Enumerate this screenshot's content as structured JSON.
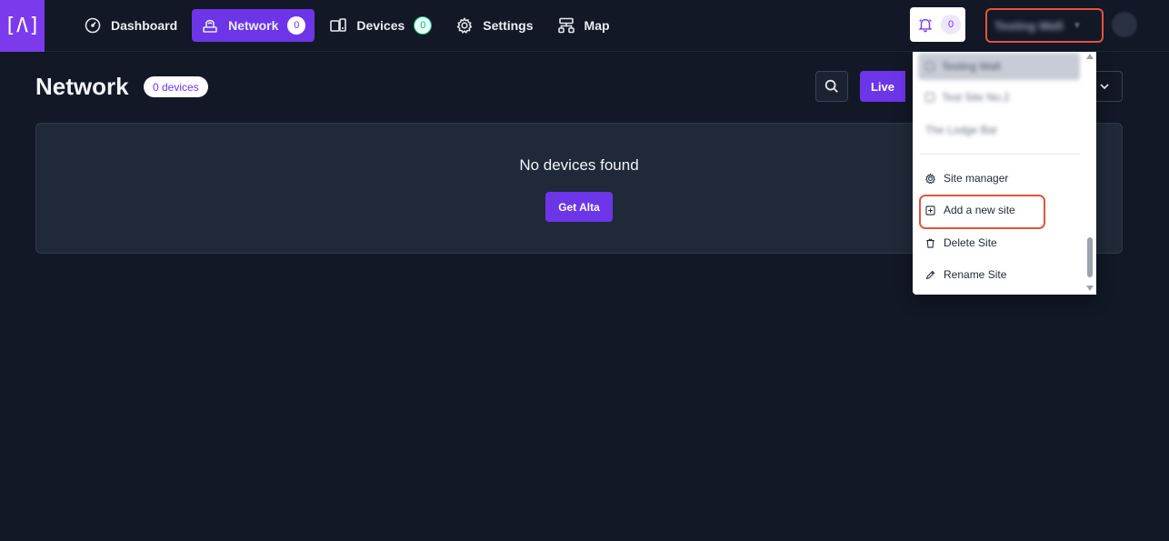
{
  "nav": {
    "logo_text": "[Λ]",
    "items": [
      {
        "label": "Dashboard",
        "icon": "gauge-icon"
      },
      {
        "label": "Network",
        "icon": "router-icon",
        "count": "0",
        "active": true
      },
      {
        "label": "Devices",
        "icon": "devices-icon",
        "count": "0"
      },
      {
        "label": "Settings",
        "icon": "gear-icon"
      },
      {
        "label": "Map",
        "icon": "sitemap-icon"
      }
    ],
    "notifications_count": "0",
    "site_selector_label": "Testing Wafi"
  },
  "page": {
    "title": "Network",
    "devices_pill": "0 devices",
    "live_label": "Live"
  },
  "empty_state": {
    "message": "No devices found",
    "button_label": "Get Alta"
  },
  "dropdown": {
    "sites": [
      "Testing Wafi",
      "Test Site No.2",
      "The Lodge Bar"
    ],
    "actions": [
      {
        "label": "Site manager",
        "icon": "gear-icon"
      },
      {
        "label": "Add a new site",
        "icon": "plus-square-icon"
      },
      {
        "label": "Delete Site",
        "icon": "trash-icon"
      },
      {
        "label": "Rename Site",
        "icon": "pencil-icon"
      }
    ]
  },
  "colors": {
    "background": "#121826",
    "accent": "#6d35e8",
    "highlight_outline": "#e5533d",
    "panel": "#1f2938"
  }
}
